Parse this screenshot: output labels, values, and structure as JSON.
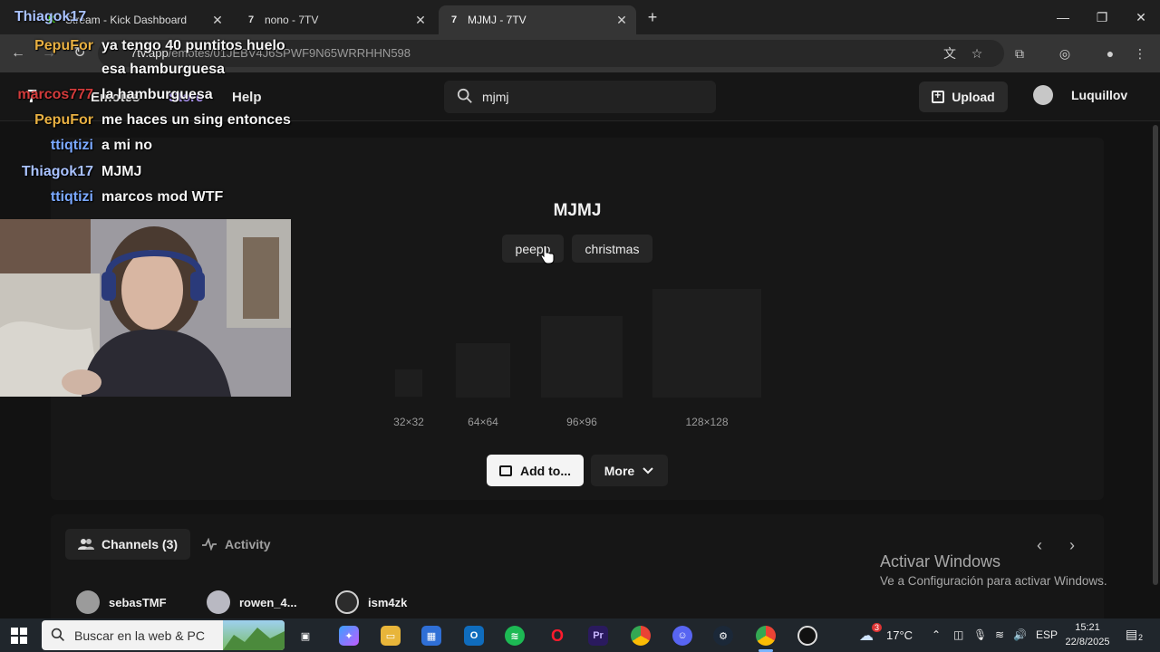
{
  "browser": {
    "tabs": [
      {
        "title": "Stream - Kick Dashboard",
        "active": false
      },
      {
        "title": "nono - 7TV",
        "active": false
      },
      {
        "title": "MJMJ - 7TV",
        "active": true
      }
    ],
    "url_host": "7tv.app",
    "url_path": "/emotes/01JEBV4J6SPWF9N65WRRHHN598"
  },
  "header": {
    "nav_emotes": "Emotes",
    "nav_store": "Store",
    "nav_help": "Help",
    "search_value": "mjmj",
    "upload_label": "Upload",
    "username": "Luquillov"
  },
  "emote": {
    "name": "MJMJ",
    "tags": [
      "peepo",
      "christmas"
    ],
    "sizes": [
      "32×32",
      "64×64",
      "96×96",
      "128×128"
    ],
    "add_label": "Add to...",
    "more_label": "More"
  },
  "tabs_section": {
    "channels_label": "Channels (3)",
    "activity_label": "Activity",
    "channels": [
      "sebasTMF",
      "rowen_4...",
      "ism4zk"
    ]
  },
  "watermark": {
    "line1": "Activar Windows",
    "line2": "Ve a Configuración para activar Windows."
  },
  "chat": [
    {
      "user": "PepuFor",
      "color": "#e8b042",
      "msg": "ya tengo 40 puntitos huelo"
    },
    {
      "user": "",
      "color": "#e8b042",
      "msg": "esa hamburguesa"
    },
    {
      "user": "marcos777",
      "color": "#d23b3b",
      "msg": "la hamburguesa"
    },
    {
      "user": "PepuFor",
      "color": "#e8b042",
      "msg": "me haces un sing entonces"
    },
    {
      "user": "ttiqtizi",
      "color": "#7aa8ff",
      "msg": "a mi no"
    },
    {
      "user": "Thiagok17",
      "color": "#a9c2ff",
      "msg": "MJMJ"
    },
    {
      "user": "ttiqtizi",
      "color": "#7aa8ff",
      "msg": "marcos mod WTF"
    }
  ],
  "chat_top_user": "Thiagok17",
  "taskbar": {
    "search_placeholder": "Buscar en la web & PC",
    "weather": "17°C",
    "weather_badge": "3",
    "lang": "ESP",
    "time": "15:21",
    "date": "22/8/2025",
    "notif_count": "2"
  }
}
